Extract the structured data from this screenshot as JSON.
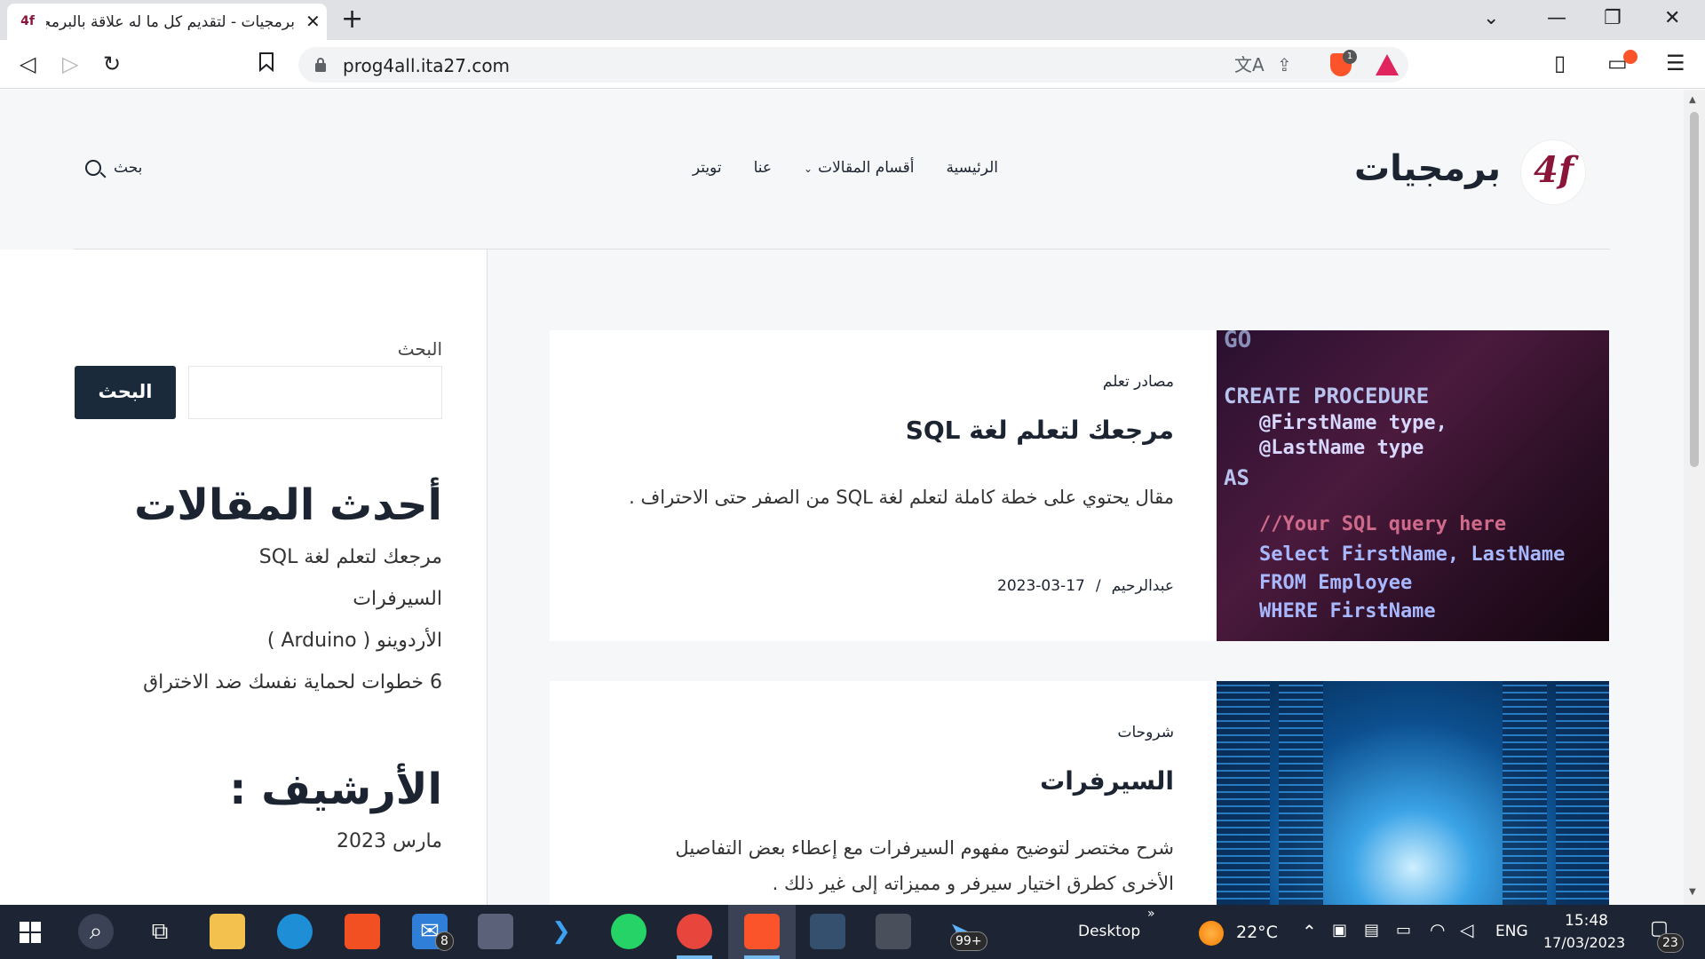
{
  "browser": {
    "tab_title": "برمجيات - لتقديم كل ما له علاقة بالبرمجة",
    "tab_favicon": "4f-logo-icon",
    "new_tab_glyph": "+",
    "close_glyph": "✕",
    "url": "prog4all.ita27.com",
    "shield_badge": "1",
    "icons": [
      "back-icon",
      "forward-icon",
      "reload-icon",
      "bookmark-icon",
      "lock-icon",
      "translate-icon",
      "share-icon",
      "brave-shield-icon",
      "brave-rewards-icon",
      "sidebar-icon",
      "wallet-icon",
      "menu-icon",
      "minimize-icon",
      "restore-icon",
      "close-icon",
      "tab-search-icon"
    ]
  },
  "site": {
    "title": "برمجيات",
    "logo_text": "4f",
    "nav": {
      "home": "الرئيسية",
      "sections": "أقسام المقالات",
      "about": "عنا",
      "twitter": "تويتر"
    },
    "search_label": "بحث"
  },
  "posts": [
    {
      "category": "مصادر تعلم",
      "title": "مرجعك لتعلم لغة SQL",
      "excerpt": "مقال يحتوي على خطة كاملة لتعلم لغة SQL من الصفر حتى الاحتراف .",
      "author": "عبدالرحيم",
      "separator": "/",
      "date": "2023-03-17",
      "image_code": [
        "GO",
        "CREATE PROCEDURE",
        "@FirstName type,",
        "@LastName type",
        "AS",
        "//Your SQL query here",
        "Select FirstName, LastName",
        "FROM Employee",
        "WHERE FirstName"
      ]
    },
    {
      "category": "شروحات",
      "title": "السيرفرات",
      "excerpt": "شرح مختصر لتوضيح مفهوم السيرفرات مع إعطاء بعض التفاصيل الأخرى كطرق اختيار سيرفر و مميزاته إلى غير ذلك ."
    }
  ],
  "sidebar": {
    "search_label": "البحث",
    "search_button": "البحث",
    "recent_heading": "أحدث المقالات",
    "recent": [
      "مرجعك لتعلم لغة SQL",
      "السيرفرات",
      "الأردوينو ( Arduino )",
      "6 خطوات لحماية نفسك ضد الاختراق"
    ],
    "archive_heading": "الأرشيف :",
    "archive": [
      "مارس 2023"
    ]
  },
  "taskbar": {
    "desktop_label": "Desktop",
    "overflow": "»",
    "temperature": "22°C",
    "language": "ENG",
    "time": "15:48",
    "date": "17/03/2023",
    "mail_badge": "8",
    "tray_badge": "99+",
    "notif_badge": "23",
    "icons": [
      "windows-start-icon",
      "search-icon",
      "task-view-icon",
      "file-explorer-icon",
      "edge-icon",
      "store-icon",
      "mail-icon",
      "calculator-icon",
      "vscode-icon",
      "whatsapp-icon",
      "chrome-icon",
      "brave-icon",
      "app-icon",
      "app2-icon",
      "app3-icon",
      "weather-icon",
      "chevron-up-icon",
      "wifi-icon",
      "volume-icon",
      "battery-icon",
      "notifications-icon"
    ]
  }
}
